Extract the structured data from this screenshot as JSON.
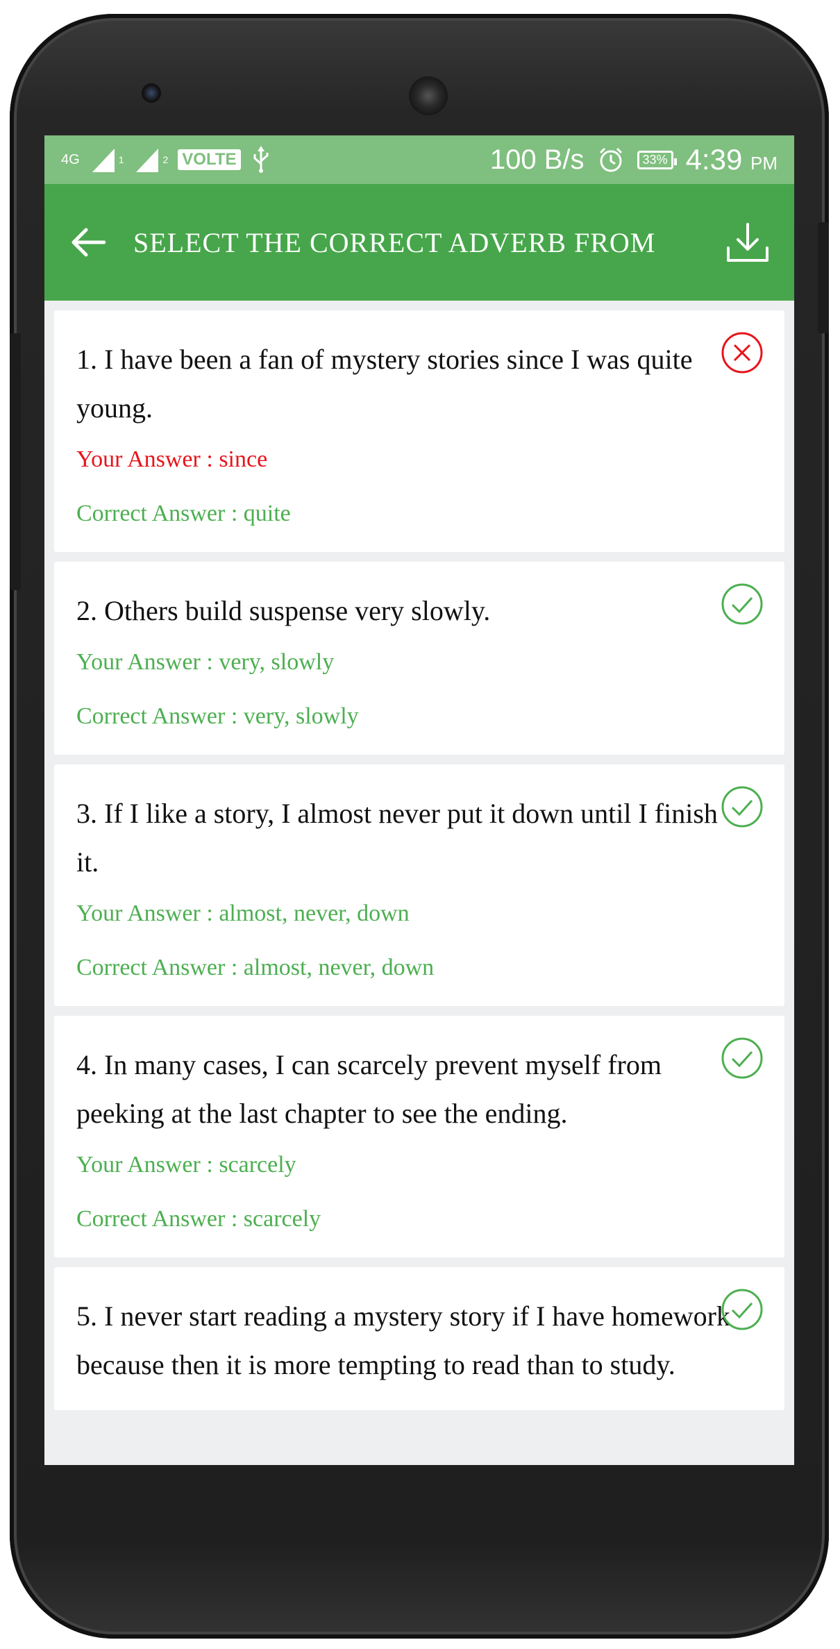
{
  "status_bar": {
    "network": "4G",
    "sim1": "1",
    "sim2": "2",
    "volte": "VOLTE",
    "speed": "100 B/s",
    "battery": "33%",
    "time": "4:39",
    "ampm": "PM"
  },
  "app_bar": {
    "title": "SELECT THE CORRECT ADVERB FROM"
  },
  "labels": {
    "your_answer": "Your Answer",
    "correct_answer": "Correct Answer",
    "separator": " : "
  },
  "questions": [
    {
      "text": "1. I have been a fan of mystery stories since I was quite young.",
      "your_answer": "since",
      "correct_answer": "quite",
      "correct": false
    },
    {
      "text": "2. Others build suspense very slowly.",
      "your_answer": "very, slowly",
      "correct_answer": "very, slowly",
      "correct": true
    },
    {
      "text": "3. If I like a story, I almost never put it down until I finish it.",
      "your_answer": "almost, never, down",
      "correct_answer": "almost, never, down",
      "correct": true
    },
    {
      "text": "4. In many cases, I can scarcely prevent myself from peeking at the last chapter to see the ending.",
      "your_answer": "scarcely",
      "correct_answer": "scarcely",
      "correct": true
    },
    {
      "text": "5. I never start reading a mystery story if I have homework because then it is more tempting to read than to study.",
      "correct": true
    }
  ],
  "colors": {
    "primary": "#47a64b",
    "status_bar": "#7fbf7f",
    "correct": "#4caf50",
    "wrong": "#e8141b"
  },
  "icons": {
    "back": "arrow-left-icon",
    "download": "download-icon",
    "wrong": "x-circle-icon",
    "correct": "check-circle-icon"
  }
}
